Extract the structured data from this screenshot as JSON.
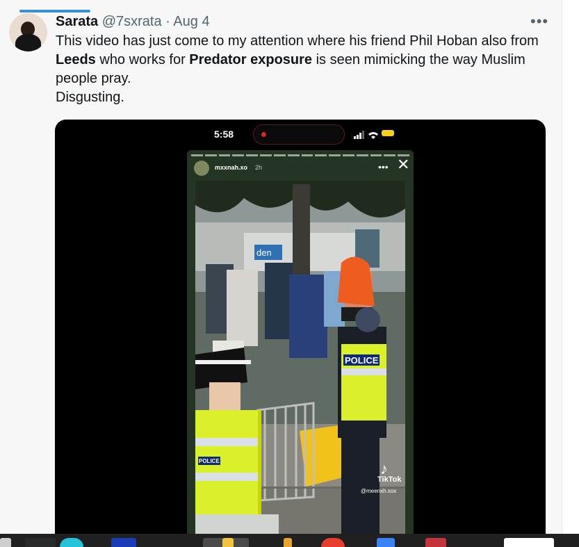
{
  "tweet": {
    "name": "Sarata",
    "handle": "@7sxrata",
    "separator": "·",
    "date": "Aug 4",
    "more": "•••",
    "text": {
      "p1": "This video has just come to my attention where his friend Phil Hoban also from ",
      "b1": "Leeds",
      "p2": " who works for ",
      "b2": "Predator exposure",
      "p3": " is seen mimicking the way Muslim people pray.",
      "line2": "Disgusting."
    }
  },
  "phone": {
    "time": "5:58",
    "story_user": "mxxnah.xo",
    "story_time": "2h",
    "story_more": "•••",
    "close": "✕",
    "tiktok_label": "TikTok",
    "tiktok_handle": "@meenxh.xox",
    "signs": {
      "police_back": "POLICE",
      "police_front": "POLICE",
      "shop_sign": "den"
    }
  },
  "colors": {
    "accent": "#3a8fd6",
    "text": "#0f1419",
    "muted": "#536471",
    "hi_vis": "#d9f02a"
  },
  "icons": [
    "more-icon",
    "record-icon",
    "signal-icon",
    "wifi-icon",
    "battery-icon",
    "close-icon",
    "tiktok-icon"
  ]
}
